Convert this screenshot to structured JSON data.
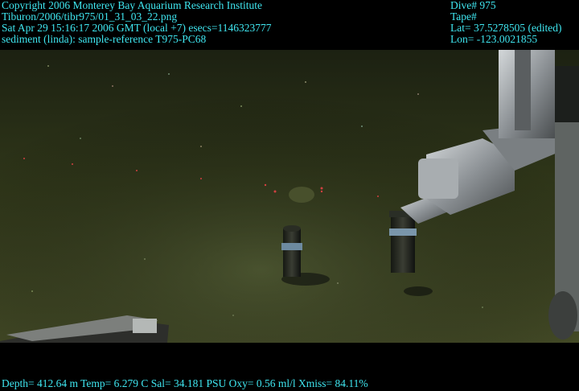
{
  "overlay": {
    "copyright": "Copyright 2006 Monterey Bay Aquarium Research Institute",
    "file_path": "Tiburon/2006/tibr975/01_31_03_22.png",
    "datetime": "Sat Apr 29 15:16:17 2006 GMT (local +7)  esecs=1146323777",
    "annotation": "sediment (linda): sample-reference T975-PC68",
    "dive": "Dive# 975",
    "tape": "Tape#",
    "lat": "Lat= 37.5278505 (edited)",
    "lon": "Lon= -123.0021855",
    "telemetry": "Depth= 412.64 m  Temp= 6.279 C  Sal= 34.181 PSU  Oxy= 0.56 ml/l  Xmiss= 84.11%"
  },
  "colors": {
    "overlay_text": "#3fe6f0",
    "seafloor": "#3b4322",
    "water": "#222816",
    "metal": "#9aa0a4"
  },
  "scene": {
    "subject": "ROV manipulator arm beside push-core samplers on muddy seafloor",
    "objects": [
      "manipulator-arm",
      "push-core-left",
      "push-core-gripped",
      "vehicle-skid-frame",
      "rov-frame-edge"
    ]
  }
}
